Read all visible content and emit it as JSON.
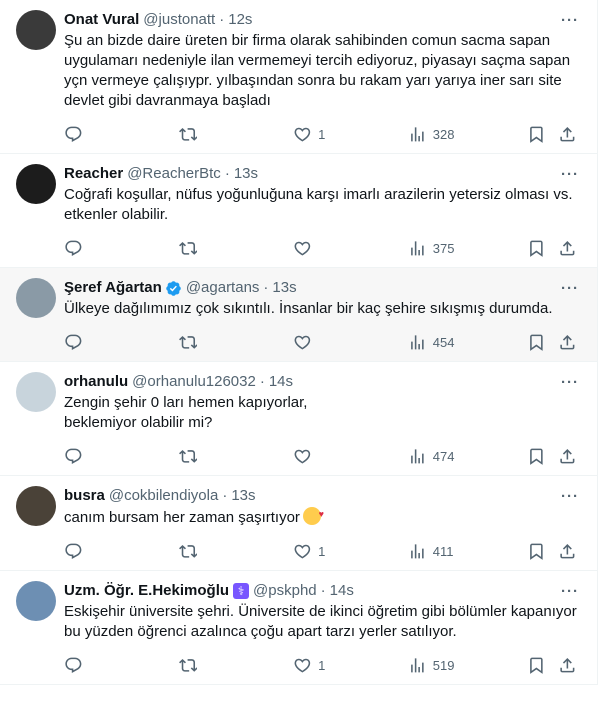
{
  "tweets": [
    {
      "name": "Onat Vural",
      "handle": "@justonatt",
      "time": "12s",
      "text": "Şu an bizde daire üreten bir firma olarak sahibinden comun sacma sapan uygulamarı nedeniyle ilan vermemeyi tercih ediyoruz, piyasayı saçma sapan yçn vermeye çalışıypr. yılbaşından sonra bu rakam yarı yarıya iner sarı site devlet gibi davranmaya başladı",
      "replies": "",
      "retweets": "",
      "likes": "1",
      "views": "328",
      "avatar_color": "#3a3a3a",
      "verified": false,
      "badge": ""
    },
    {
      "name": "Reacher",
      "handle": "@ReacherBtc",
      "time": "13s",
      "text": "Coğrafi koşullar, nüfus yoğunluğuna karşı imarlı arazilerin yetersiz olması vs. etkenler olabilir.",
      "replies": "",
      "retweets": "",
      "likes": "",
      "views": "375",
      "avatar_color": "#1c1c1c",
      "verified": false,
      "badge": ""
    },
    {
      "name": "Şeref Ağartan",
      "handle": "@agartans",
      "time": "13s",
      "text": "Ülkeye dağılımımız çok sıkıntılı. İnsanlar bir kaç şehire sıkışmış durumda.",
      "replies": "",
      "retweets": "",
      "likes": "",
      "views": "454",
      "avatar_color": "#8a9aa6",
      "verified": true,
      "badge": ""
    },
    {
      "name": "orhanulu",
      "handle": "@orhanulu126032",
      "time": "14s",
      "text": "Zengin şehir 0 ları hemen kapıyorlar,\nbeklemiyor olabilir mi?",
      "replies": "",
      "retweets": "",
      "likes": "",
      "views": "474",
      "avatar_color": "#c8d4dc",
      "verified": false,
      "badge": ""
    },
    {
      "name": "busra",
      "handle": "@cokbilendiyola",
      "time": "13s",
      "text": "canım bursam her zaman şaşırtıyor",
      "replies": "",
      "retweets": "",
      "likes": "1",
      "views": "411",
      "avatar_color": "#4a4238",
      "verified": false,
      "badge": "",
      "emoji": "smiling-face-with-hearts"
    },
    {
      "name": "Uzm. Öğr. E.Hekimoğlu",
      "handle": "@pskphd",
      "time": "14s",
      "text": "Eskişehir üniversite şehri. Üniversite de ikinci öğretim gibi bölümler kapanıyor bu yüzden öğrenci azalınca çoğu apart tarzı yerler satılıyor.",
      "replies": "",
      "retweets": "",
      "likes": "1",
      "views": "519",
      "avatar_color": "#6d8fb3",
      "verified": false,
      "badge": "⚕"
    }
  ],
  "colors": {
    "muted": "#536471",
    "text": "#0f1419",
    "verified": "#1d9bf0",
    "divider": "#eff3f4",
    "hover_bg": "#f7f7f7"
  },
  "icons": [
    "reply-icon",
    "retweet-icon",
    "like-icon",
    "views-icon",
    "bookmark-icon",
    "share-icon",
    "more-icon",
    "verified-icon"
  ]
}
